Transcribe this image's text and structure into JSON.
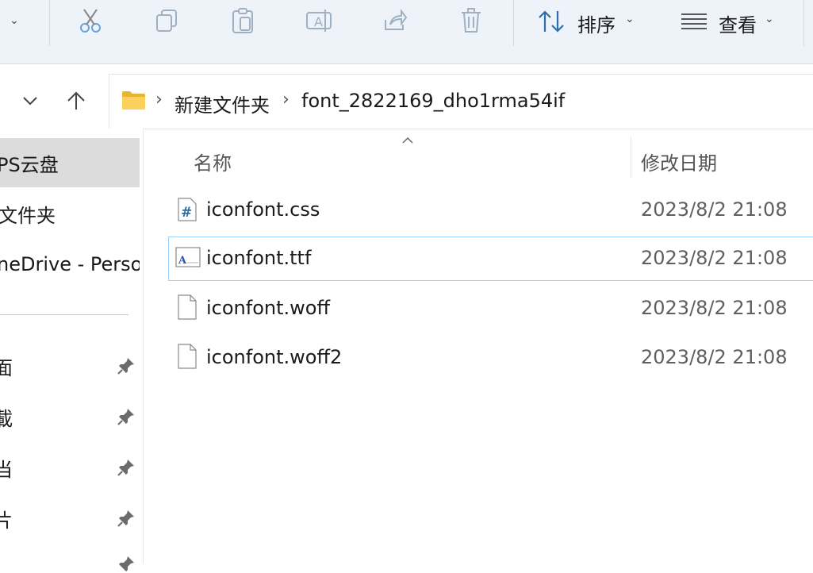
{
  "toolbar": {
    "sort_label": "排序",
    "view_label": "查看",
    "icons": [
      "scissors-icon",
      "copy-icon",
      "paste-icon",
      "rename-icon",
      "share-icon",
      "delete-icon"
    ]
  },
  "breadcrumb": {
    "folder": "新建文件夹",
    "current": "font_2822169_dho1rma54if"
  },
  "sidebar": {
    "items": [
      {
        "label": "PS云盘"
      },
      {
        "label": "文件夹"
      },
      {
        "label": "neDrive - Persor"
      }
    ],
    "pinned": [
      {
        "label": "面"
      },
      {
        "label": "載"
      },
      {
        "label": "当"
      },
      {
        "label": "片"
      }
    ]
  },
  "columns": {
    "name": "名称",
    "date": "修改日期"
  },
  "files": [
    {
      "name": "iconfont.css",
      "date": "2023/8/2 21:08",
      "icon": "css-file-icon"
    },
    {
      "name": "iconfont.ttf",
      "date": "2023/8/2 21:08",
      "icon": "font-file-icon"
    },
    {
      "name": "iconfont.woff",
      "date": "2023/8/2 21:08",
      "icon": "blank-file-icon"
    },
    {
      "name": "iconfont.woff2",
      "date": "2023/8/2 21:08",
      "icon": "blank-file-icon"
    }
  ]
}
